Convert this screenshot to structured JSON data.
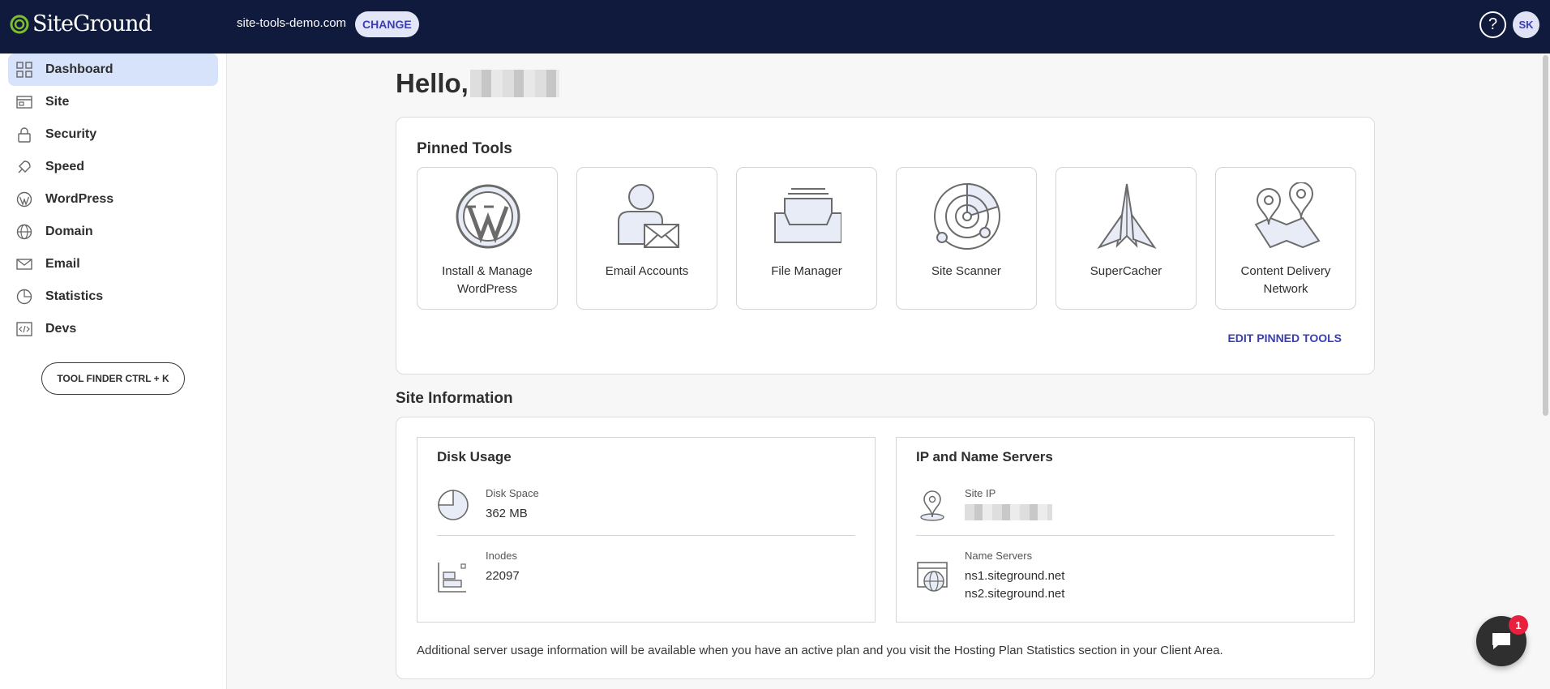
{
  "app": {
    "logo_text": "SiteGround",
    "domain": "site-tools-demo.com",
    "change_label": "CHANGE",
    "help_label": "?",
    "avatar_initials": "SK",
    "colors": {
      "topbar": "#0f1a3c",
      "accent": "#3a3db5",
      "active_nav": "#d6e3fb",
      "logo_green": "#7fbf2e"
    }
  },
  "sidebar": {
    "items": [
      {
        "label": "Dashboard",
        "icon": "dashboard-grid-icon",
        "active": true
      },
      {
        "label": "Site",
        "icon": "site-icon"
      },
      {
        "label": "Security",
        "icon": "lock-icon"
      },
      {
        "label": "Speed",
        "icon": "rocket-icon"
      },
      {
        "label": "WordPress",
        "icon": "wordpress-icon"
      },
      {
        "label": "Domain",
        "icon": "globe-icon"
      },
      {
        "label": "Email",
        "icon": "envelope-icon"
      },
      {
        "label": "Statistics",
        "icon": "pie-chart-icon"
      },
      {
        "label": "Devs",
        "icon": "code-icon"
      }
    ],
    "tool_finder_label": "TOOL FINDER CTRL + K"
  },
  "main": {
    "greeting": "Hello,",
    "pinned": {
      "title": "Pinned Tools",
      "tools": [
        {
          "label": "Install & Manage WordPress",
          "icon": "wordpress-logo-icon"
        },
        {
          "label": "Email Accounts",
          "icon": "email-accounts-icon"
        },
        {
          "label": "File Manager",
          "icon": "file-tray-icon"
        },
        {
          "label": "Site Scanner",
          "icon": "radar-icon"
        },
        {
          "label": "SuperCacher",
          "icon": "paper-rocket-icon"
        },
        {
          "label": "Content Delivery Network",
          "icon": "map-pins-icon"
        }
      ],
      "edit_label": "EDIT PINNED TOOLS"
    },
    "site_info": {
      "title": "Site Information",
      "disk": {
        "title": "Disk Usage",
        "space_label": "Disk Space",
        "space_value": "362 MB",
        "inodes_label": "Inodes",
        "inodes_value": "22097"
      },
      "servers": {
        "title": "IP and Name Servers",
        "ip_label": "Site IP",
        "ns_label": "Name Servers",
        "ns1": "ns1.siteground.net",
        "ns2": "ns2.siteground.net"
      },
      "footnote": "Additional server usage information will be available when you have an active plan and you visit the Hosting Plan Statistics section in your Client Area."
    }
  },
  "chat": {
    "badge_count": "1"
  }
}
